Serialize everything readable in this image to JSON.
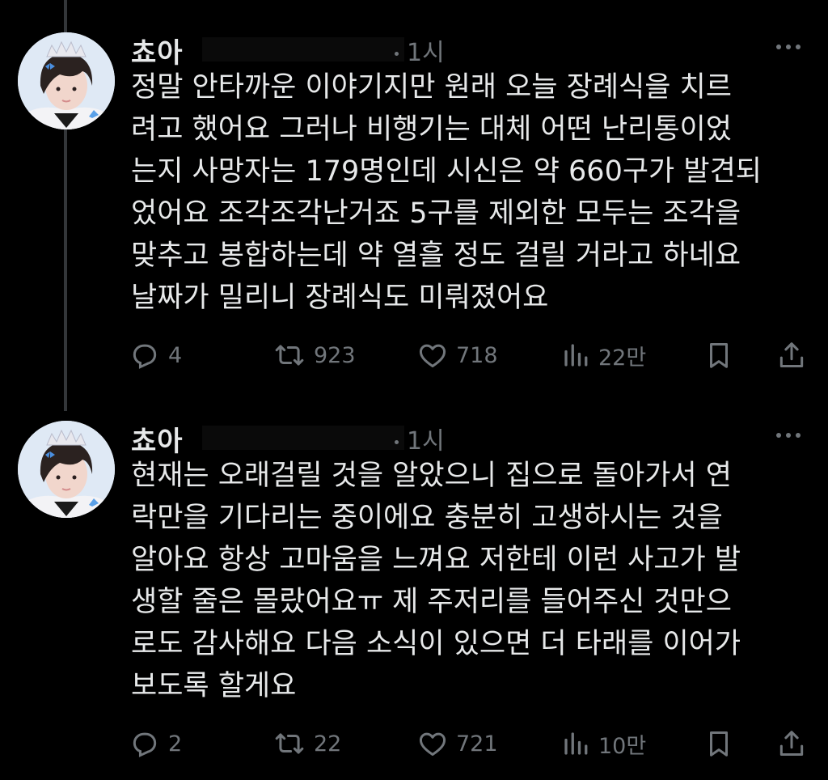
{
  "tweets": [
    {
      "author": "쵸아",
      "time": "1시",
      "lines": [
        "정말 안타까운 이야기지만 원래 오늘 장례식을 치르",
        "려고 했어요 그러나 비행기는 대체 어떤 난리통이었",
        "는지 사망자는 179명인데 시신은 약 660구가 발견되",
        "었어요 조각조각난거죠 5구를 제외한 모두는 조각을",
        "맞추고 봉합하는데 약 열흘 정도 걸릴 거라고 하네요",
        "날짜가 밀리니 장례식도 미뤄졌어요"
      ],
      "replies": "4",
      "retweets": "923",
      "likes": "718",
      "views": "22만"
    },
    {
      "author": "쵸아",
      "time": "1시",
      "lines": [
        "현재는 오래걸릴 것을 알았으니 집으로 돌아가서 연",
        "락만을 기다리는 중이에요 충분히 고생하시는 것을",
        "알아요 항상 고마움을 느껴요 저한테 이런 사고가 발",
        "생할 줄은 몰랐어요ㅠ 제 주저리를 들어주신 것만으",
        "로도 감사해요 다음 소식이 있으면 더 타래를 이어가",
        "보도록 할게요"
      ],
      "replies": "2",
      "retweets": "22",
      "likes": "721",
      "views": "10만"
    }
  ],
  "icons": {
    "reply": "reply-icon",
    "retweet": "retweet-icon",
    "like": "heart-icon",
    "views": "views-icon",
    "bookmark": "bookmark-icon",
    "share": "share-icon",
    "more": "more-icon"
  },
  "colors": {
    "background": "#000000",
    "text": "#e7e9ea",
    "muted": "#71767b"
  }
}
